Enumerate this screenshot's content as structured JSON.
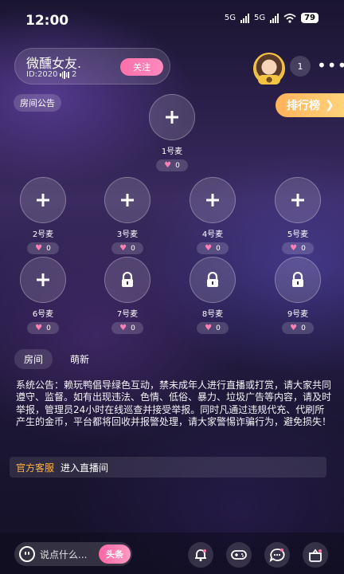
{
  "status_bar": {
    "time": "12:00",
    "network_1": "5G",
    "network_2": "5G",
    "battery": "79"
  },
  "room": {
    "title": "微醺女友.",
    "id_label": "ID:2020",
    "listener_count": "2",
    "follow_label": "关注",
    "avatar_badge": "☻",
    "online_count": "1",
    "more_label": "•••"
  },
  "notice_tag": "房间公告",
  "rank_button": {
    "label": "排行榜",
    "arrow": "❯"
  },
  "seats": [
    {
      "label": "1号麦",
      "hearts": "0",
      "locked": false
    },
    {
      "label": "2号麦",
      "hearts": "0",
      "locked": false
    },
    {
      "label": "3号麦",
      "hearts": "0",
      "locked": false
    },
    {
      "label": "4号麦",
      "hearts": "0",
      "locked": false
    },
    {
      "label": "5号麦",
      "hearts": "0",
      "locked": false
    },
    {
      "label": "6号麦",
      "hearts": "0",
      "locked": false
    },
    {
      "label": "7号麦",
      "hearts": "0",
      "locked": true
    },
    {
      "label": "8号麦",
      "hearts": "0",
      "locked": true
    },
    {
      "label": "9号麦",
      "hearts": "0",
      "locked": true
    }
  ],
  "chat_tabs": [
    {
      "label": "房间",
      "active": true
    },
    {
      "label": "萌新",
      "active": false
    }
  ],
  "announcement": "系统公告：赖玩鸭倡导绿色互动，禁未成年人进行直播或打赏，请大家共同遵守、监督。如有出现违法、色情、低俗、暴力、垃圾广告等内容，请及时举报，管理员24小时在线巡查并接受举报。同时凡通过违规代充、代刷所产生的金币，平台都将回收并报警处理，请大家警惕诈骗行为，避免损失！",
  "enter_message": {
    "sender": "官方客服",
    "text": "进入直播间"
  },
  "bottom_bar": {
    "placeholder": "说点什么...",
    "headline_label": "头条",
    "tools": [
      "bell-mic-icon",
      "gamepad-icon",
      "message-icon",
      "gift-box-icon"
    ]
  }
}
